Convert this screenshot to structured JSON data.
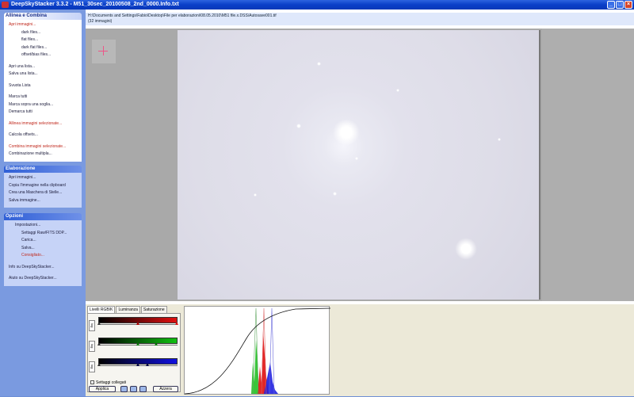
{
  "window": {
    "title": "DeepSkyStacker 3.3.2 - M51_30sec_20100508_2nd_0000.Info.txt"
  },
  "sidebar": {
    "register_panel": {
      "title": "Allinea e Combina",
      "items": [
        {
          "label": "Apri immagini...",
          "red": true,
          "indent": 0
        },
        {
          "label": "dark files...",
          "indent": 2
        },
        {
          "label": "flat files...",
          "indent": 2
        },
        {
          "label": "dark flat files...",
          "indent": 2
        },
        {
          "label": "offset/bias files...",
          "indent": 2
        },
        {
          "gap": true
        },
        {
          "label": "Apri una lista...",
          "indent": 0
        },
        {
          "label": "Salva una lista...",
          "indent": 0
        },
        {
          "gap": true
        },
        {
          "label": "Svuota Lista",
          "indent": 0
        },
        {
          "gap": true
        },
        {
          "label": "Marca tutti",
          "indent": 0
        },
        {
          "label": "Marca sopra una soglia...",
          "indent": 0
        },
        {
          "label": "Demarca tutti",
          "indent": 0
        },
        {
          "gap": true
        },
        {
          "label": "Allinea immagini selezionate...",
          "red": true,
          "indent": 0
        },
        {
          "gap": true
        },
        {
          "label": "Calcola offsets...",
          "indent": 0
        },
        {
          "gap": true
        },
        {
          "label": "Combina immagini selezionate...",
          "red": true,
          "indent": 0
        },
        {
          "label": "Combinazione multipla...",
          "indent": 0
        }
      ]
    },
    "processing_panel": {
      "title": "Elaborazione",
      "items": [
        {
          "label": "Apri immagini...",
          "indent": 0
        },
        {
          "label": "Copia l'immagine nella clipboard",
          "indent": 0
        },
        {
          "label": "Crea una Maschera di Stelle...",
          "indent": 0
        },
        {
          "label": "Salva immagine...",
          "indent": 0
        }
      ]
    },
    "options_panel": {
      "title": "Opzioni",
      "items": [
        {
          "label": "Impostazioni...",
          "indent": 1
        },
        {
          "label": "Settaggi Raw/FITS DDP...",
          "indent": 2
        },
        {
          "label": "Carica...",
          "indent": 2
        },
        {
          "label": "Salva...",
          "indent": 2
        },
        {
          "label": "Consigliato...",
          "red": true,
          "indent": 2
        },
        {
          "gap": true
        },
        {
          "label": "Info su DeepSkyStacker...",
          "indent": 0
        },
        {
          "gap": true
        },
        {
          "label": "Aiuto su DeepSkyStacker...",
          "indent": 0
        }
      ]
    }
  },
  "main": {
    "path": "H:\\Documents and Settings\\Fabio\\Desktop\\File per elaborazioni\\08.05.2010\\M51 file.x.DSS\\Autosave001.tif",
    "count": "(32 immagini)"
  },
  "bottom": {
    "tabs": [
      "Livelli RGB/K",
      "Luminanza",
      "Saturazione"
    ],
    "log_label": "log",
    "linked_label": "Settaggi collegati",
    "apply_label": "Applica",
    "reset_label": "Azzera"
  },
  "colors": {
    "red": "#e01010",
    "green": "#10c010",
    "blue": "#1010e0"
  }
}
